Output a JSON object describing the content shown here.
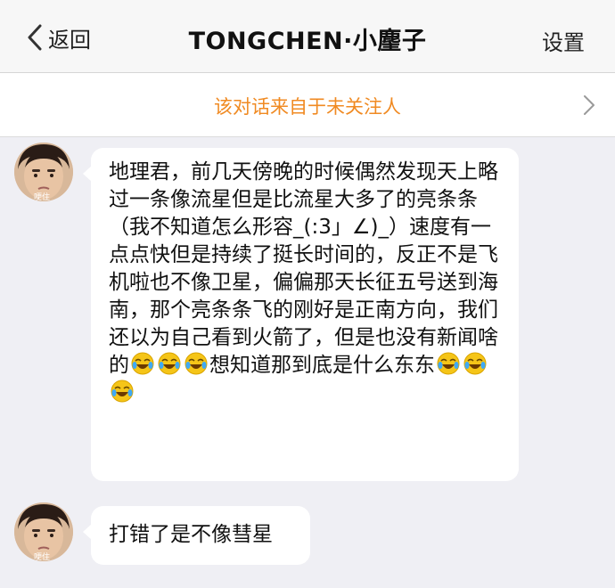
{
  "nav": {
    "back_label": "返回",
    "title": "TONGCHEN·小麈子",
    "settings_label": "设置"
  },
  "notice": {
    "text": "该对话来自于未关注人"
  },
  "messages": [
    {
      "avatar_caption": "哽住",
      "line1": "地理君，前几天傍晚的时候偶然发现天上略过一条像流星但是比流星大多了的亮条条（我不知道怎么形容_(:3」∠)_）速度有一点点快但是持续了挺长时间的，反正不是飞机啦也不像卫星，偏偏那天长征五号送到海南，那个亮条条飞的刚好是正南方向，我们还以为自己看到火箭了，但是也没有新闻啥的",
      "line2": "想知道那到底是什么东东"
    },
    {
      "avatar_caption": "哽住",
      "text": "打错了是不像彗星"
    }
  ],
  "colors": {
    "notice": "#f08a22",
    "background": "#efeff4",
    "bubble": "#ffffff"
  },
  "icons": {
    "back": "chevron-left-icon",
    "notice_arrow": "chevron-right-icon",
    "emoji": "laugh-cry-emoji-icon"
  }
}
